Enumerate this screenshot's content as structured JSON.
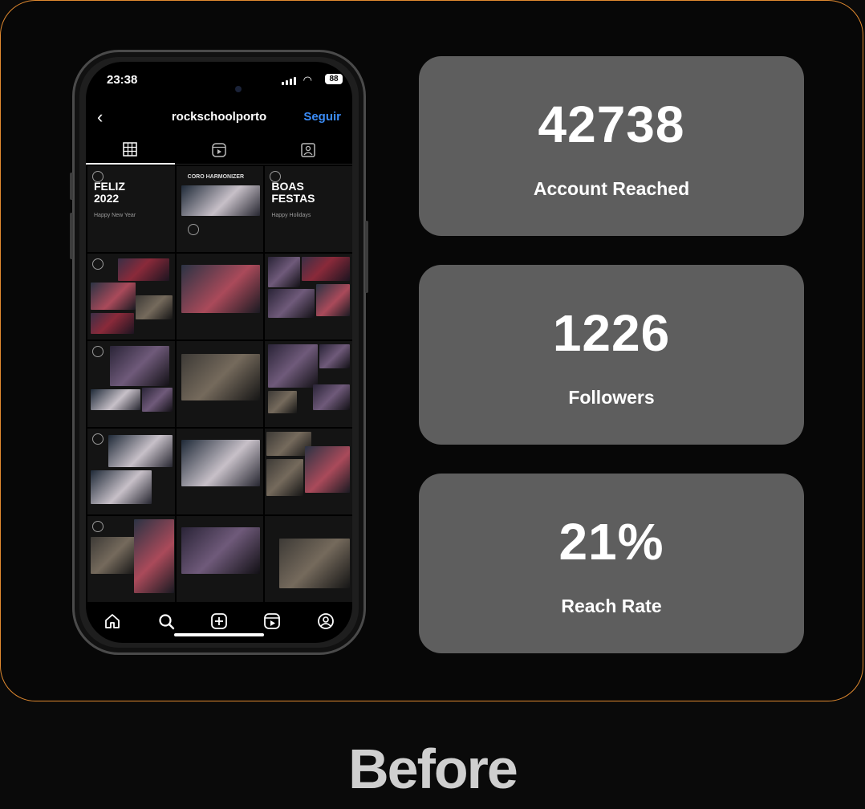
{
  "phone": {
    "status": {
      "time": "23:38",
      "battery": "88"
    },
    "header": {
      "back_icon": "chevron-left-icon",
      "username": "rockschoolporto",
      "follow_label": "Seguir"
    },
    "tabs": [
      {
        "icon": "grid-icon",
        "active": true
      },
      {
        "icon": "reels-icon",
        "active": false
      },
      {
        "icon": "tagged-icon",
        "active": false
      }
    ],
    "posts": {
      "feliz": {
        "title_line1": "FELIZ",
        "title_line2": "2022",
        "subtitle": "Happy New Year"
      },
      "coro": {
        "header": "CORO HARMONIZER"
      },
      "boas": {
        "title_line1": "BOAS",
        "title_line2": "FESTAS",
        "subtitle": "Happy Holidays"
      }
    },
    "bottom_nav": [
      "home-icon",
      "search-icon",
      "create-icon",
      "reels-icon",
      "profile-icon"
    ]
  },
  "stats": [
    {
      "value": "42738",
      "label": "Account Reached"
    },
    {
      "value": "1226",
      "label": "Followers"
    },
    {
      "value": "21%",
      "label": "Reach Rate"
    }
  ],
  "caption": "Before",
  "colors": {
    "accent_border": "#e0892f",
    "card_bg": "#5e5e5e",
    "follow_blue": "#3b8cf7"
  }
}
